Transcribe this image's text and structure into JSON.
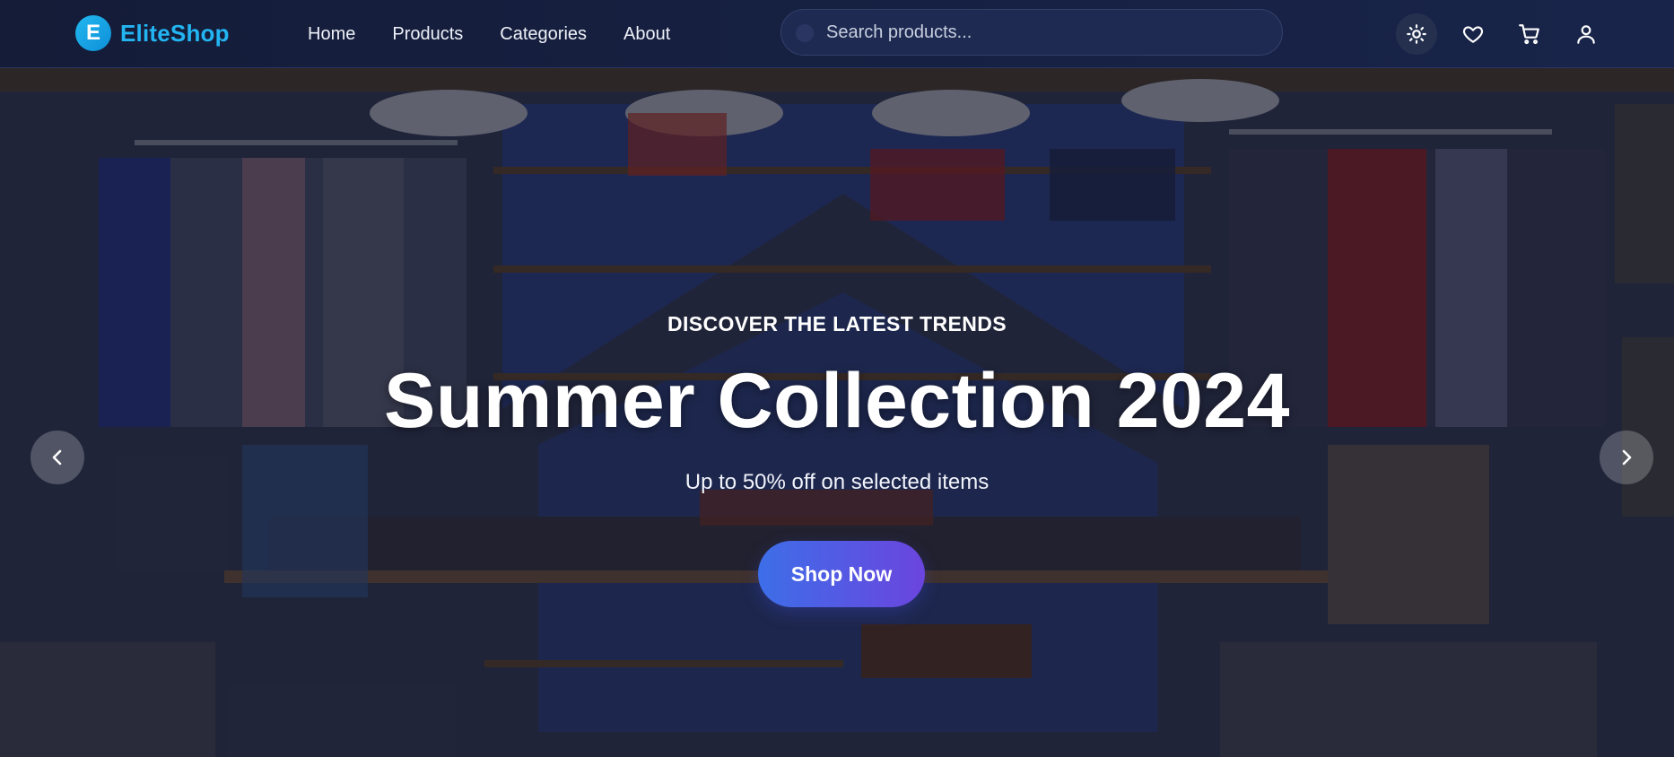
{
  "navbar": {
    "brand_letter": "E",
    "brand_name": "EliteShop",
    "links": [
      "Home",
      "Products",
      "Categories",
      "About"
    ],
    "search_placeholder": "Search products...",
    "action_icons": [
      "sun-icon",
      "heart-icon",
      "cart-icon",
      "user-icon"
    ]
  },
  "hero": {
    "eyebrow": "DISCOVER THE LATEST TRENDS",
    "headline": "Summer Collection 2024",
    "subline": "Up to 50% off on selected items",
    "cta_label": "Shop Now",
    "prev_icon": "chevron-left-icon",
    "next_icon": "chevron-right-icon"
  },
  "colors": {
    "navbar_bg": "#141c38",
    "brand_accent": "#23b5f2",
    "cta_gradient_start": "#3d6ee8",
    "cta_gradient_end": "#6b45de"
  }
}
